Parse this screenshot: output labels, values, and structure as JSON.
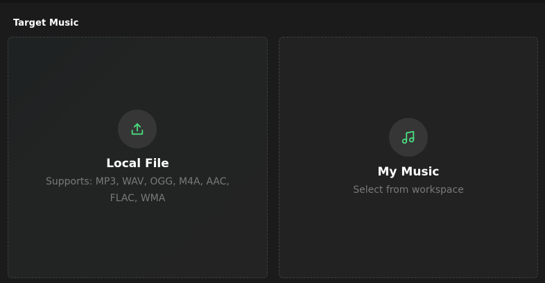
{
  "section": {
    "title": "Target Music"
  },
  "cards": {
    "local": {
      "icon": "upload-icon",
      "title": "Local File",
      "subtitle": "Supports: MP3, WAV, OGG, M4A, AAC, FLAC, WMA"
    },
    "music": {
      "icon": "music-note-icon",
      "title": "My Music",
      "subtitle": "Select from workspace"
    }
  },
  "colors": {
    "accent": "#4ade80",
    "background": "#1b1b1b",
    "card": "#222222",
    "icon_circle": "#363636"
  }
}
